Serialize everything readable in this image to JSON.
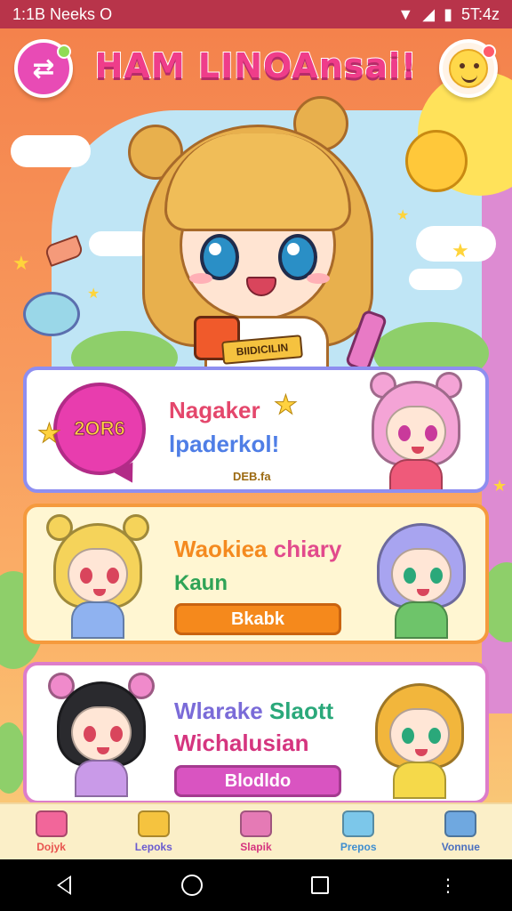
{
  "status_bar": {
    "time": "1:1B Neeks",
    "circle": "O",
    "right_time": "5T:4z"
  },
  "header": {
    "title": "HAM LINOAnsai!"
  },
  "hero": {
    "sign_text": "BIIDICILIN"
  },
  "cards": [
    {
      "bubble_text": "2OR6",
      "line1": "Nagaker",
      "line2": "lpaderkol!",
      "line3": "DEB.fa"
    },
    {
      "line1a": "Waokiea",
      "line1b": "chiary",
      "line2": "Kaun",
      "button": "Bkabk"
    },
    {
      "line1a": "Wlarake",
      "line1b": "Slaott",
      "line2": "Wichalusian",
      "button": "Blodldo"
    }
  ],
  "bottom_nav": [
    {
      "label": "Dojyk",
      "icon": "house-icon",
      "color": "#e8544f",
      "icon_color": "#f2669a"
    },
    {
      "label": "Lepoks",
      "icon": "toy-icon",
      "color": "#6a5bd0",
      "icon_color": "#f5c33f"
    },
    {
      "label": "Slapik",
      "icon": "calendar-icon",
      "color": "#d5357f",
      "icon_color": "#e57ab5"
    },
    {
      "label": "Prepos",
      "icon": "camera-icon",
      "color": "#3f8ed0",
      "icon_color": "#7cc7ea"
    },
    {
      "label": "Vonnue",
      "icon": "home-icon",
      "color": "#4a6fbf",
      "icon_color": "#6fa8e0"
    }
  ],
  "colors": {
    "status_bar": "#b8344a",
    "title": "#ef3d8a",
    "accent_pink": "#e84bb5"
  }
}
